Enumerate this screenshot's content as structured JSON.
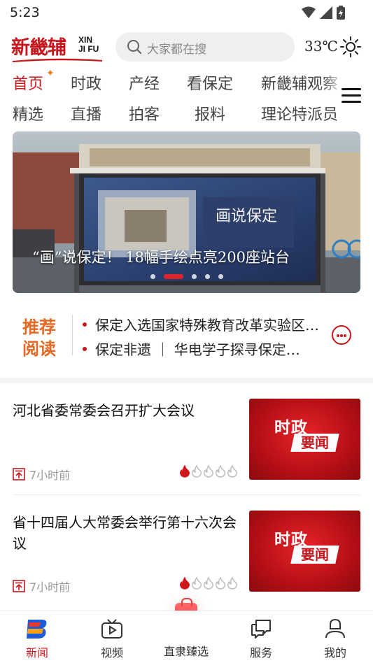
{
  "status_bar": {
    "time": "5:23"
  },
  "header": {
    "logo_cn": "新畿辅",
    "logo_en_1": "XIN",
    "logo_en_2": "JI FU",
    "search_placeholder": "大家都在搜",
    "temperature": "33℃",
    "weather_icon": "sun-icon"
  },
  "channels": {
    "row1": [
      "首页",
      "时政",
      "产经",
      "看保定",
      "新畿辅观察"
    ],
    "row2": [
      "精选",
      "直播",
      "拍客",
      "报料",
      "理论特派员"
    ],
    "active": "首页"
  },
  "banner": {
    "caption": "“画”说保定！ 18幅手绘点亮200座站台",
    "slide_count": 5,
    "active_slide": 2,
    "board_text": "画说保定"
  },
  "recommended": {
    "label_1": "推荐",
    "label_2": "阅读",
    "items": [
      "保定入选国家特殊教育改革实验区…",
      "保定非遗 ｜ 华电学子探寻保定…"
    ]
  },
  "news": [
    {
      "title": "河北省委常委会召开扩大会议",
      "time": "7小时前",
      "heat": 1,
      "heat_max": 5,
      "thumb_line1": "时政",
      "thumb_line2": "要闻"
    },
    {
      "title": "省十四届人大常委会举行第十六次会议",
      "time": "7小时前",
      "heat": 1,
      "heat_max": 5,
      "thumb_line1": "时政",
      "thumb_line2": "要闻"
    }
  ],
  "bottom_nav": {
    "items": [
      "新闻",
      "视频",
      "直隶臻选",
      "服务",
      "我的"
    ],
    "active": "新闻"
  },
  "colors": {
    "brand_red": "#c8161d",
    "accent_orange": "#e36a25"
  }
}
